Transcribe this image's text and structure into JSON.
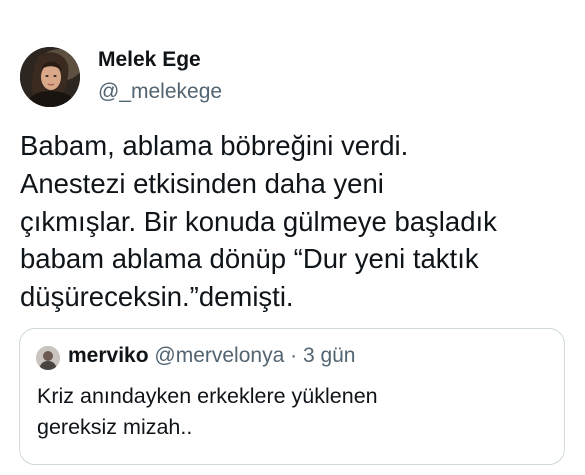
{
  "tweet": {
    "author": {
      "name": "Melek Ege",
      "handle": "@_melekege",
      "avatar_icon": "user-photo-avatar"
    },
    "text_lines": [
      "Babam, ablama böbreğini verdi.",
      "Anestezi etkisinden daha yeni",
      "çıkmışlar. Bir konuda gülmeye başladık",
      "babam ablama dönüp “Dur yeni taktık",
      "düşüreceksin.”demişti."
    ]
  },
  "quoted_tweet": {
    "author": {
      "name": "merviko",
      "handle": "@mervelonya",
      "separator": " · ",
      "time": "3 gün",
      "avatar_icon": "user-photo-avatar"
    },
    "text_lines": [
      "Kriz anındayken erkeklere yüklenen",
      "gereksiz mizah.."
    ]
  },
  "colors": {
    "text_primary": "#0f1419",
    "text_secondary": "#536471",
    "border": "#cfd9de",
    "background": "#ffffff"
  }
}
